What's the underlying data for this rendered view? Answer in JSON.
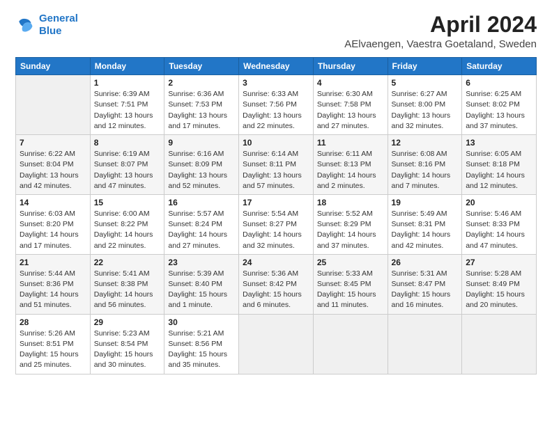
{
  "logo": {
    "line1": "General",
    "line2": "Blue"
  },
  "title": "April 2024",
  "subtitle": "AElvaengen, Vaestra Goetaland, Sweden",
  "weekdays": [
    "Sunday",
    "Monday",
    "Tuesday",
    "Wednesday",
    "Thursday",
    "Friday",
    "Saturday"
  ],
  "weeks": [
    [
      {
        "day": "",
        "info": ""
      },
      {
        "day": "1",
        "info": "Sunrise: 6:39 AM\nSunset: 7:51 PM\nDaylight: 13 hours\nand 12 minutes."
      },
      {
        "day": "2",
        "info": "Sunrise: 6:36 AM\nSunset: 7:53 PM\nDaylight: 13 hours\nand 17 minutes."
      },
      {
        "day": "3",
        "info": "Sunrise: 6:33 AM\nSunset: 7:56 PM\nDaylight: 13 hours\nand 22 minutes."
      },
      {
        "day": "4",
        "info": "Sunrise: 6:30 AM\nSunset: 7:58 PM\nDaylight: 13 hours\nand 27 minutes."
      },
      {
        "day": "5",
        "info": "Sunrise: 6:27 AM\nSunset: 8:00 PM\nDaylight: 13 hours\nand 32 minutes."
      },
      {
        "day": "6",
        "info": "Sunrise: 6:25 AM\nSunset: 8:02 PM\nDaylight: 13 hours\nand 37 minutes."
      }
    ],
    [
      {
        "day": "7",
        "info": "Sunrise: 6:22 AM\nSunset: 8:04 PM\nDaylight: 13 hours\nand 42 minutes."
      },
      {
        "day": "8",
        "info": "Sunrise: 6:19 AM\nSunset: 8:07 PM\nDaylight: 13 hours\nand 47 minutes."
      },
      {
        "day": "9",
        "info": "Sunrise: 6:16 AM\nSunset: 8:09 PM\nDaylight: 13 hours\nand 52 minutes."
      },
      {
        "day": "10",
        "info": "Sunrise: 6:14 AM\nSunset: 8:11 PM\nDaylight: 13 hours\nand 57 minutes."
      },
      {
        "day": "11",
        "info": "Sunrise: 6:11 AM\nSunset: 8:13 PM\nDaylight: 14 hours\nand 2 minutes."
      },
      {
        "day": "12",
        "info": "Sunrise: 6:08 AM\nSunset: 8:16 PM\nDaylight: 14 hours\nand 7 minutes."
      },
      {
        "day": "13",
        "info": "Sunrise: 6:05 AM\nSunset: 8:18 PM\nDaylight: 14 hours\nand 12 minutes."
      }
    ],
    [
      {
        "day": "14",
        "info": "Sunrise: 6:03 AM\nSunset: 8:20 PM\nDaylight: 14 hours\nand 17 minutes."
      },
      {
        "day": "15",
        "info": "Sunrise: 6:00 AM\nSunset: 8:22 PM\nDaylight: 14 hours\nand 22 minutes."
      },
      {
        "day": "16",
        "info": "Sunrise: 5:57 AM\nSunset: 8:24 PM\nDaylight: 14 hours\nand 27 minutes."
      },
      {
        "day": "17",
        "info": "Sunrise: 5:54 AM\nSunset: 8:27 PM\nDaylight: 14 hours\nand 32 minutes."
      },
      {
        "day": "18",
        "info": "Sunrise: 5:52 AM\nSunset: 8:29 PM\nDaylight: 14 hours\nand 37 minutes."
      },
      {
        "day": "19",
        "info": "Sunrise: 5:49 AM\nSunset: 8:31 PM\nDaylight: 14 hours\nand 42 minutes."
      },
      {
        "day": "20",
        "info": "Sunrise: 5:46 AM\nSunset: 8:33 PM\nDaylight: 14 hours\nand 47 minutes."
      }
    ],
    [
      {
        "day": "21",
        "info": "Sunrise: 5:44 AM\nSunset: 8:36 PM\nDaylight: 14 hours\nand 51 minutes."
      },
      {
        "day": "22",
        "info": "Sunrise: 5:41 AM\nSunset: 8:38 PM\nDaylight: 14 hours\nand 56 minutes."
      },
      {
        "day": "23",
        "info": "Sunrise: 5:39 AM\nSunset: 8:40 PM\nDaylight: 15 hours\nand 1 minute."
      },
      {
        "day": "24",
        "info": "Sunrise: 5:36 AM\nSunset: 8:42 PM\nDaylight: 15 hours\nand 6 minutes."
      },
      {
        "day": "25",
        "info": "Sunrise: 5:33 AM\nSunset: 8:45 PM\nDaylight: 15 hours\nand 11 minutes."
      },
      {
        "day": "26",
        "info": "Sunrise: 5:31 AM\nSunset: 8:47 PM\nDaylight: 15 hours\nand 16 minutes."
      },
      {
        "day": "27",
        "info": "Sunrise: 5:28 AM\nSunset: 8:49 PM\nDaylight: 15 hours\nand 20 minutes."
      }
    ],
    [
      {
        "day": "28",
        "info": "Sunrise: 5:26 AM\nSunset: 8:51 PM\nDaylight: 15 hours\nand 25 minutes."
      },
      {
        "day": "29",
        "info": "Sunrise: 5:23 AM\nSunset: 8:54 PM\nDaylight: 15 hours\nand 30 minutes."
      },
      {
        "day": "30",
        "info": "Sunrise: 5:21 AM\nSunset: 8:56 PM\nDaylight: 15 hours\nand 35 minutes."
      },
      {
        "day": "",
        "info": ""
      },
      {
        "day": "",
        "info": ""
      },
      {
        "day": "",
        "info": ""
      },
      {
        "day": "",
        "info": ""
      }
    ]
  ]
}
